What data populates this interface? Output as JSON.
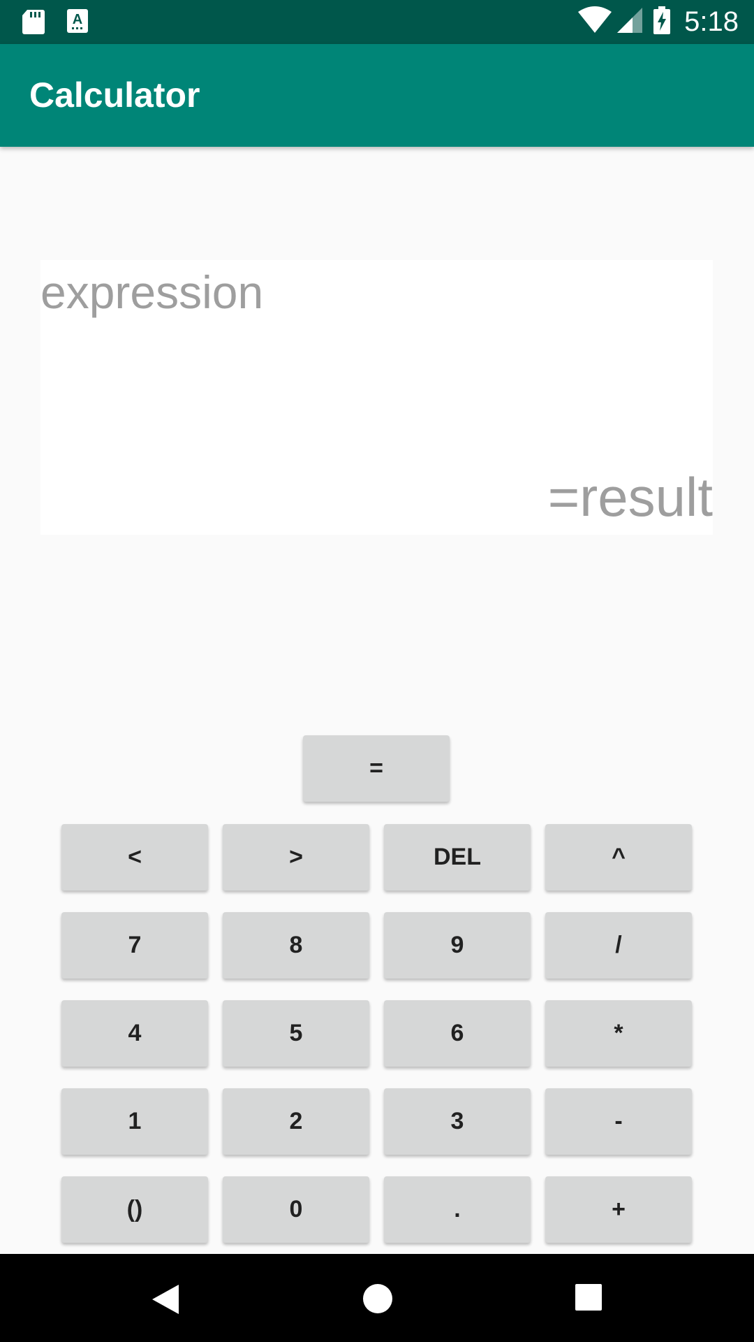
{
  "status_bar": {
    "time": "5:18",
    "left_icons": [
      "sd-card-icon",
      "keyboard-a-icon"
    ],
    "right_icons": [
      "wifi-icon",
      "signal-icon",
      "battery-charging-icon"
    ]
  },
  "app_bar": {
    "title": "Calculator"
  },
  "display": {
    "expression_placeholder": "expression",
    "result_placeholder": "=result"
  },
  "keypad": {
    "equals": "=",
    "rows": [
      [
        "<",
        ">",
        "DEL",
        "^"
      ],
      [
        "7",
        "8",
        "9",
        "/"
      ],
      [
        "4",
        "5",
        "6",
        "*"
      ],
      [
        "1",
        "2",
        "3",
        "-"
      ],
      [
        "()",
        "0",
        ".",
        "+"
      ]
    ]
  },
  "nav_bar": {
    "icons": [
      "back-icon",
      "home-icon",
      "recents-icon"
    ]
  },
  "colors": {
    "status_bar": "#00574b",
    "app_bar": "#008577",
    "background": "#fafafa",
    "button": "#d6d7d7",
    "placeholder_text": "#9e9e9e"
  }
}
